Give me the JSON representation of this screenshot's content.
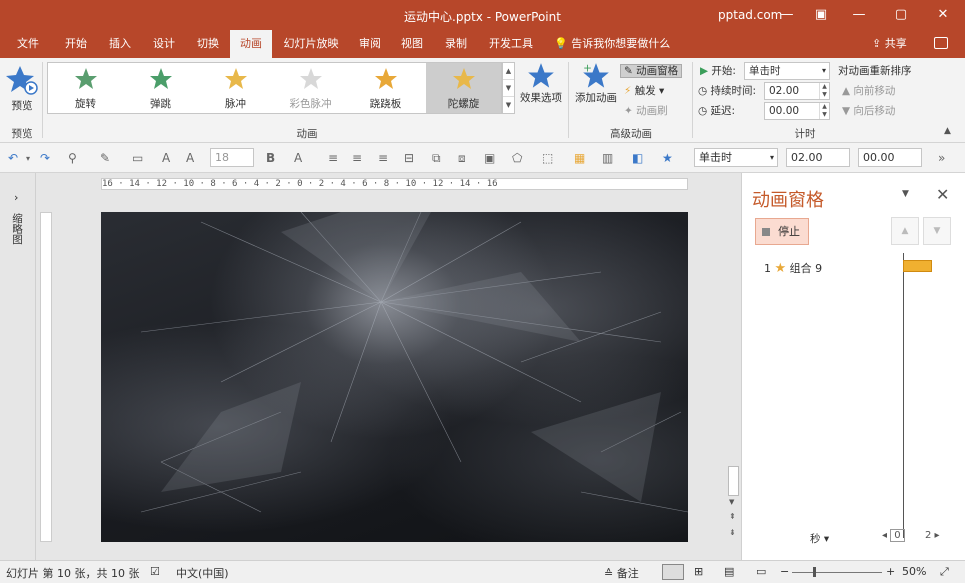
{
  "titlebar": {
    "title": "运动中心.pptx - PowerPoint",
    "account": "pptad.com",
    "minimize": "—",
    "restore": "▢",
    "close": "✕",
    "ribbon_opts": "▣"
  },
  "tabs": [
    "文件",
    "开始",
    "插入",
    "设计",
    "切换",
    "动画",
    "幻灯片放映",
    "审阅",
    "视图",
    "录制",
    "开发工具"
  ],
  "tellme": "告诉我你想要做什么",
  "share": "共享",
  "ribbon": {
    "preview": "预览",
    "preview_group": "预览",
    "gallery": [
      {
        "label": "旋转",
        "color": "#5a9e6f"
      },
      {
        "label": "弹跳",
        "color": "#4b9e6a"
      },
      {
        "label": "脉冲",
        "color": "#e8b84a"
      },
      {
        "label": "彩色脉冲",
        "color": "#cccccc"
      },
      {
        "label": "跷跷板",
        "color": "#e8a838"
      },
      {
        "label": "陀螺旋",
        "color": "#e8b84a"
      }
    ],
    "effect_options": "效果选项",
    "animation_group": "动画",
    "add_animation": "添加动画",
    "animation_pane": "动画窗格",
    "trigger": "触发",
    "animation_painter": "动画刷",
    "advanced_group": "高级动画",
    "start_label": "开始:",
    "start_value": "单击时",
    "duration_label": "持续时间:",
    "duration_value": "02.00",
    "delay_label": "延迟:",
    "delay_value": "00.00",
    "timing_group": "计时",
    "reorder_title": "对动画重新排序",
    "move_earlier": "向前移动",
    "move_later": "向后移动"
  },
  "qat": {
    "font_size": "18",
    "start": "单击时",
    "duration": "02.00",
    "delay": "00.00"
  },
  "thumb_label": "缩略图",
  "ruler_text": "16 · 14 · 12 · 10 · 8 · 6 · 4 · 2 · 0 · 2 · 4 · 6 · 8 · 10 · 12 · 14 · 16",
  "anim_pane": {
    "title": "动画窗格",
    "stop": "停止",
    "item_number": "1",
    "item_name": "组合 9",
    "seconds": "秒",
    "scale_start": "0",
    "scale_end": "2"
  },
  "statusbar": {
    "slide_info": "幻灯片 第 10 张，共 10 张",
    "language": "中文(中国)",
    "notes": "备注",
    "zoom": "50%"
  },
  "colors": {
    "accent": "#b7472a",
    "pane_title": "#c55a2a",
    "timeline_bar": "#f0b030"
  }
}
